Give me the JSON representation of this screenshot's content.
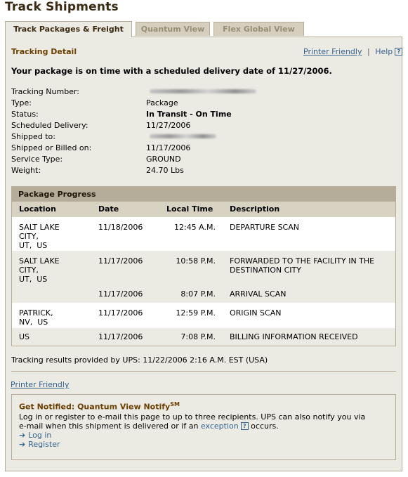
{
  "page_title": "Track Shipments",
  "tabs": [
    {
      "label": "Track Packages & Freight"
    },
    {
      "label": "Quantum View"
    },
    {
      "label": "Flex Global View"
    }
  ],
  "detail": {
    "heading": "Tracking Detail",
    "printer_friendly": "Printer Friendly",
    "separator": "|",
    "help": "Help",
    "help_icon": "?",
    "summary": "Your package is on time with a scheduled delivery date of 11/27/2006."
  },
  "info": {
    "tracking_number_label": "Tracking Number:",
    "type_label": "Type:",
    "type_value": "Package",
    "status_label": "Status:",
    "status_value": "In Transit - On Time",
    "scheduled_delivery_label": "Scheduled Delivery:",
    "scheduled_delivery_value": "11/27/2006",
    "shipped_to_label": "Shipped to:",
    "shipped_on_label": "Shipped or Billed on:",
    "shipped_on_value": "11/17/2006",
    "service_type_label": "Service Type:",
    "service_type_value": "GROUND",
    "weight_label": "Weight:",
    "weight_value": "24.70 Lbs"
  },
  "progress": {
    "title": "Package Progress",
    "columns": [
      "Location",
      "Date",
      "Local Time",
      "Description"
    ],
    "rows": [
      {
        "location": "SALT LAKE\nCITY,\nUT,  US",
        "date": "11/18/2006",
        "time": "12:45 A.M.",
        "description": "DEPARTURE SCAN"
      },
      {
        "location": "SALT LAKE\nCITY,\nUT,  US",
        "date": "11/17/2006",
        "time": "10:58 P.M.",
        "description": "FORWARDED TO THE FACILITY IN THE DESTINATION CITY"
      },
      {
        "location": "",
        "date": "11/17/2006",
        "time": "8:07 P.M.",
        "description": "ARRIVAL SCAN"
      },
      {
        "location": "PATRICK,\nNV,  US",
        "date": "11/17/2006",
        "time": "12:59 P.M.",
        "description": "ORIGIN SCAN"
      },
      {
        "location": "US",
        "date": "11/17/2006",
        "time": "7:08 P.M.",
        "description": "BILLING INFORMATION RECEIVED"
      }
    ]
  },
  "footer_note": "Tracking results provided by UPS:  11/22/2006 2:16 A.M.  EST (USA)",
  "bottom_printer_friendly": "Printer Friendly",
  "notify": {
    "title": "Get Notified: Quantum View Notify",
    "title_sup": "SM",
    "line1": "Log in or register to e-mail this page to up to three recipients. UPS can also notify you via",
    "line2_pre": "e-mail when this shipment is delivered or if an ",
    "line2_link": "exception",
    "line2_post": " occurs.",
    "login": "Log in",
    "register": "Register",
    "arrow_glyph": "➔"
  },
  "colors": {
    "brown_heading": "#6b3f00",
    "link_blue": "#33638f",
    "panel_bg": "#ecebe3",
    "border": "#b5ad99"
  }
}
